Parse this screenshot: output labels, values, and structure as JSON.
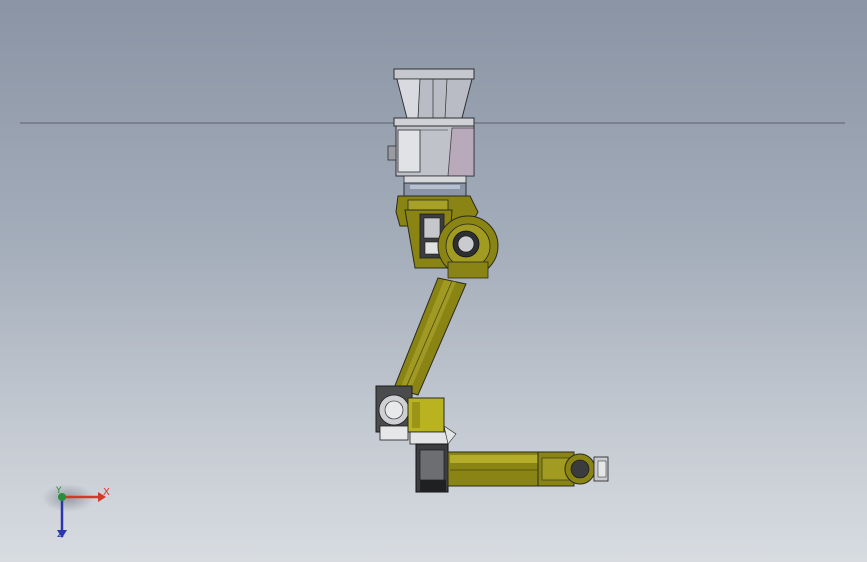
{
  "viewport": {
    "background_top": "#8a94a4",
    "background_bottom": "#d8dce1"
  },
  "model": {
    "name": "robot-arm-assembly",
    "colors": {
      "arm": "#8a8414",
      "arm_light": "#b3ad2a",
      "arm_dark": "#4d4a0b",
      "base": "#b9bcc4",
      "base_dark": "#6e7079",
      "motor": "#c8cacd",
      "motor_dark": "#3a3b3f",
      "edge": "#2b2b1a"
    }
  },
  "triad": {
    "x_label": "X",
    "y_label": "Y",
    "z_label": "Z",
    "x_color": "#d03a2a",
    "y_color": "#2a8f3a",
    "z_color": "#2a36b0"
  }
}
